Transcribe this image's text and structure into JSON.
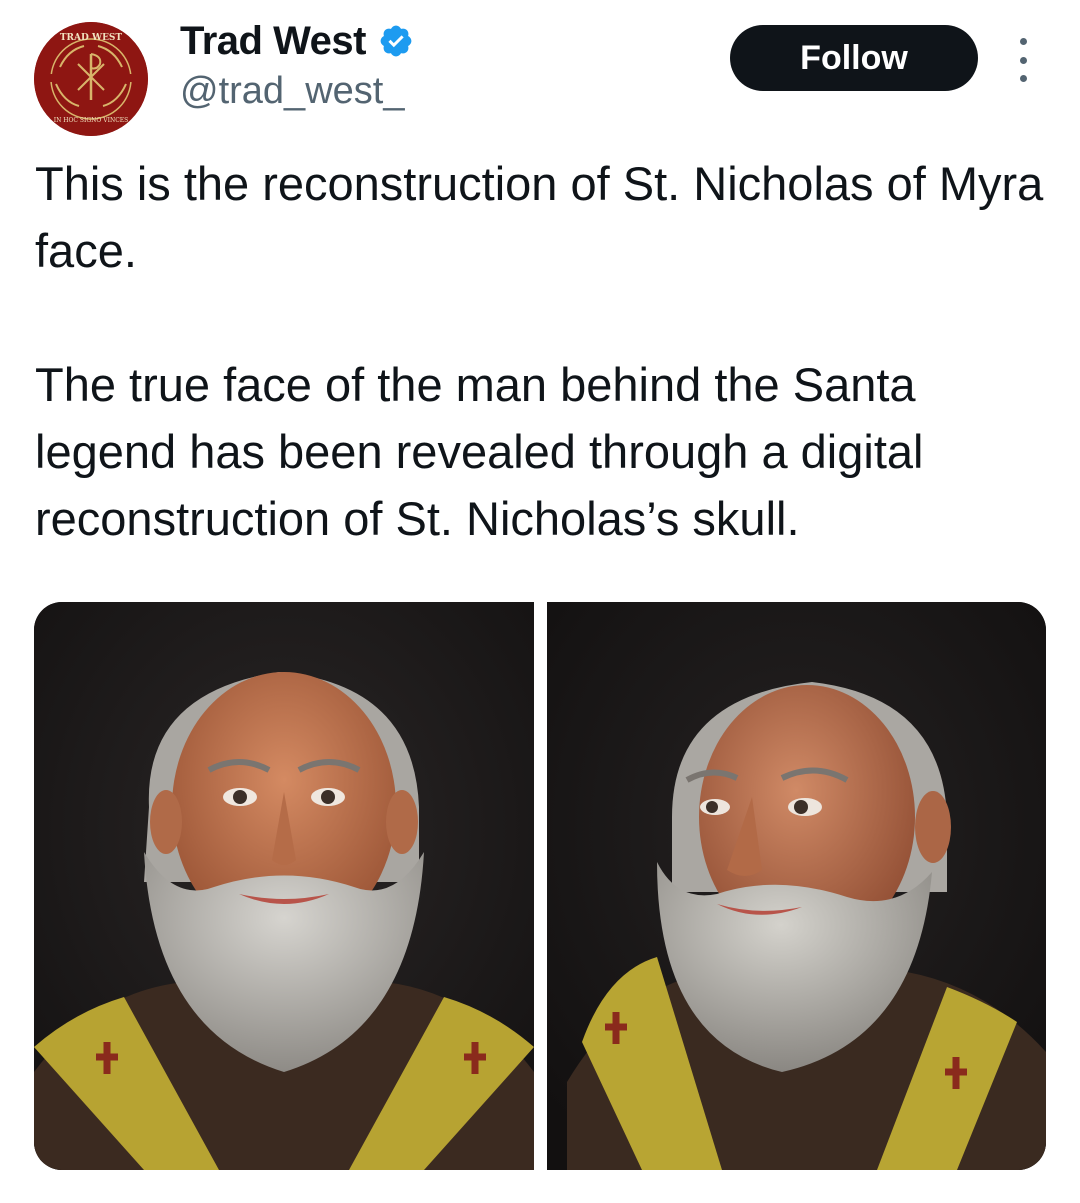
{
  "author": {
    "display_name": "Trad West",
    "handle": "@trad_west_",
    "avatar_text_top": "TRAD WEST",
    "avatar_text_bottom": "IN HOC SIGNO VINCES",
    "verified": true
  },
  "actions": {
    "follow_label": "Follow",
    "more_icon": "more-vertical-icon"
  },
  "tweet": {
    "paragraph_1": "This is the reconstruction of St. Nicholas of Myra face.",
    "paragraph_2": "The true face of the man behind the Santa legend has been revealed through a digital reconstruction of St. Nicholas’s skull."
  },
  "colors": {
    "avatar_red": "#8e1612",
    "verified_blue": "#1d9bf0",
    "follow_bg": "#0f1419",
    "secondary_text": "#536471"
  }
}
